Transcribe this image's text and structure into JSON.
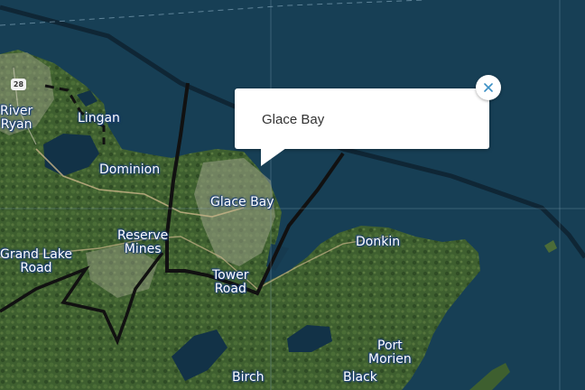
{
  "map": {
    "places": [
      {
        "id": "river-ryan",
        "label": "River\nRyan"
      },
      {
        "id": "lingan",
        "label": "Lingan"
      },
      {
        "id": "dominion",
        "label": "Dominion"
      },
      {
        "id": "glace-bay",
        "label": "Glace Bay"
      },
      {
        "id": "reserve-mines",
        "label": "Reserve\nMines"
      },
      {
        "id": "grand-lake-road",
        "label": "Grand Lake\nRoad"
      },
      {
        "id": "tower-road",
        "label": "Tower\nRoad"
      },
      {
        "id": "donkin",
        "label": "Donkin"
      },
      {
        "id": "port-morien",
        "label": "Port\nMorien"
      },
      {
        "id": "birch-grove",
        "label": "Birch"
      },
      {
        "id": "black-brook",
        "label": "Black"
      }
    ],
    "route_shield": "28",
    "colors": {
      "water": "#173f55",
      "land": "#3d5e2e",
      "boundary": "#111111",
      "label_halo": "#1c3f78"
    }
  },
  "popup": {
    "title": "Glace Bay",
    "close_icon": "close-icon"
  }
}
